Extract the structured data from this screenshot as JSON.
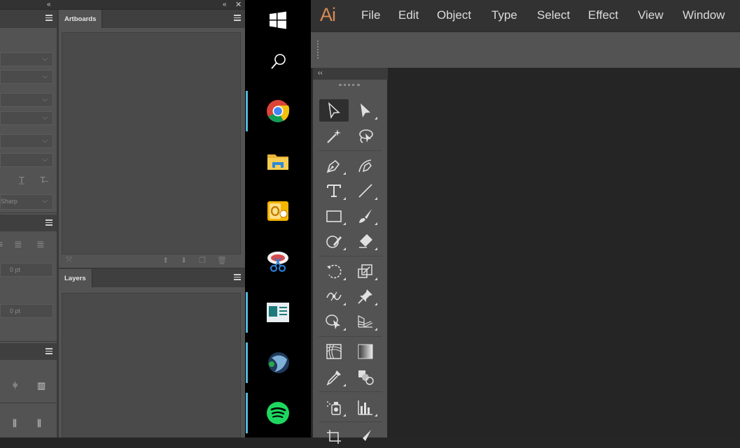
{
  "left_panels": {
    "artboards_tab": "Artboards",
    "layers_tab": "Layers",
    "character": {
      "font_style_partial": "Sharp"
    },
    "paragraph": {
      "indent_value_1": "0 pt",
      "indent_value_2": "0 pt"
    }
  },
  "taskbar": {
    "items": [
      {
        "name": "start-button"
      },
      {
        "name": "search-button"
      },
      {
        "name": "chrome-app"
      },
      {
        "name": "file-explorer-app"
      },
      {
        "name": "outlook-app"
      },
      {
        "name": "snipping-tool-app"
      },
      {
        "name": "screen-app"
      },
      {
        "name": "teamspeak-app"
      },
      {
        "name": "spotify-app"
      }
    ],
    "accent_color": "#54b6d6"
  },
  "illustrator": {
    "logo": "Ai",
    "logo_color": "#d58a54",
    "menu": [
      "File",
      "Edit",
      "Object",
      "Type",
      "Select",
      "Effect",
      "View",
      "Window"
    ],
    "toolbox_collapse": "‹‹"
  }
}
